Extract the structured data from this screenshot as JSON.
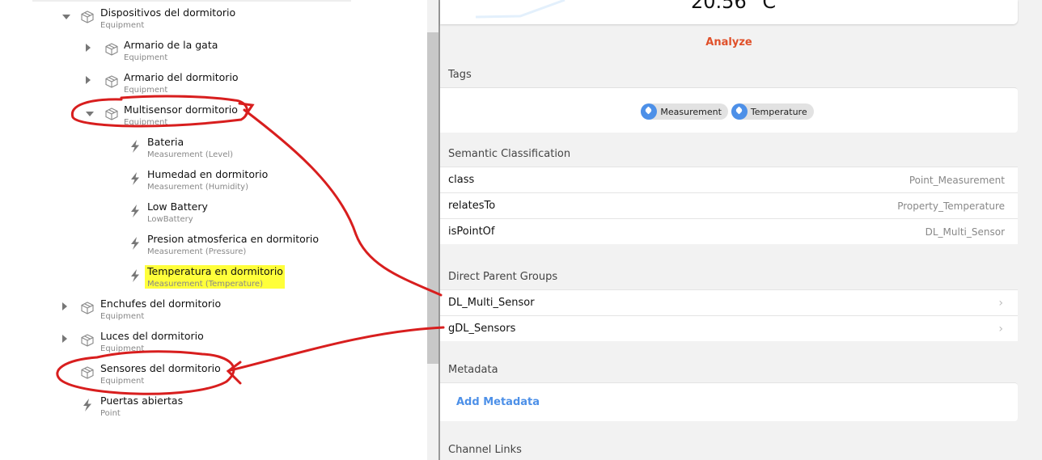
{
  "tree": [
    {
      "title": "Dispositivos del dormitorio",
      "sub": "Equipment",
      "type": "equipment",
      "arrow": "down",
      "level": 0
    },
    {
      "title": "Armario de la gata",
      "sub": "Equipment",
      "type": "equipment",
      "arrow": "right",
      "level": 1
    },
    {
      "title": "Armario del dormitorio",
      "sub": "Equipment",
      "type": "equipment",
      "arrow": "right",
      "level": 1
    },
    {
      "title": "Multisensor dormitorio",
      "sub": "Equipment",
      "type": "equipment",
      "arrow": "down",
      "level": 1
    },
    {
      "title": "Bateria",
      "sub": "Measurement (Level)",
      "type": "point",
      "level": 2
    },
    {
      "title": "Humedad en dormitorio",
      "sub": "Measurement (Humidity)",
      "type": "point",
      "level": 2
    },
    {
      "title": "Low Battery",
      "sub": "LowBattery",
      "type": "point",
      "level": 2
    },
    {
      "title": "Presion atmosferica en dormitorio",
      "sub": "Measurement (Pressure)",
      "type": "point",
      "level": 2
    },
    {
      "title": "Temperatura en dormitorio",
      "sub": "Measurement (Temperature)",
      "type": "point",
      "level": 2,
      "highlight": true
    },
    {
      "title": "Enchufes del dormitorio",
      "sub": "Equipment",
      "type": "equipment",
      "arrow": "right",
      "level": 0
    },
    {
      "title": "Luces del dormitorio",
      "sub": "Equipment",
      "type": "equipment",
      "arrow": "right",
      "level": 0
    },
    {
      "title": "Sensores del dormitorio",
      "sub": "Equipment",
      "type": "equipment",
      "level": 0
    },
    {
      "title": "Puertas abiertas",
      "sub": "Point",
      "type": "point",
      "level": 0
    }
  ],
  "detail": {
    "state": "20.56 °C",
    "analyze": "Analyze",
    "tags_header": "Tags",
    "tags": [
      "Measurement",
      "Temperature"
    ],
    "semantic_header": "Semantic Classification",
    "semantic": [
      {
        "k": "class",
        "v": "Point_Measurement"
      },
      {
        "k": "relatesTo",
        "v": "Property_Temperature"
      },
      {
        "k": "isPointOf",
        "v": "DL_Multi_Sensor"
      }
    ],
    "groups_header": "Direct Parent Groups",
    "groups": [
      "DL_Multi_Sensor",
      "gDL_Sensors"
    ],
    "metadata_header": "Metadata",
    "add_metadata": "Add Metadata",
    "channel_header": "Channel Links"
  },
  "colors": {
    "accent": "#4d90e8",
    "analyze": "#e0502a",
    "annotation": "#d81e1e",
    "highlight": "#ffff3a"
  }
}
